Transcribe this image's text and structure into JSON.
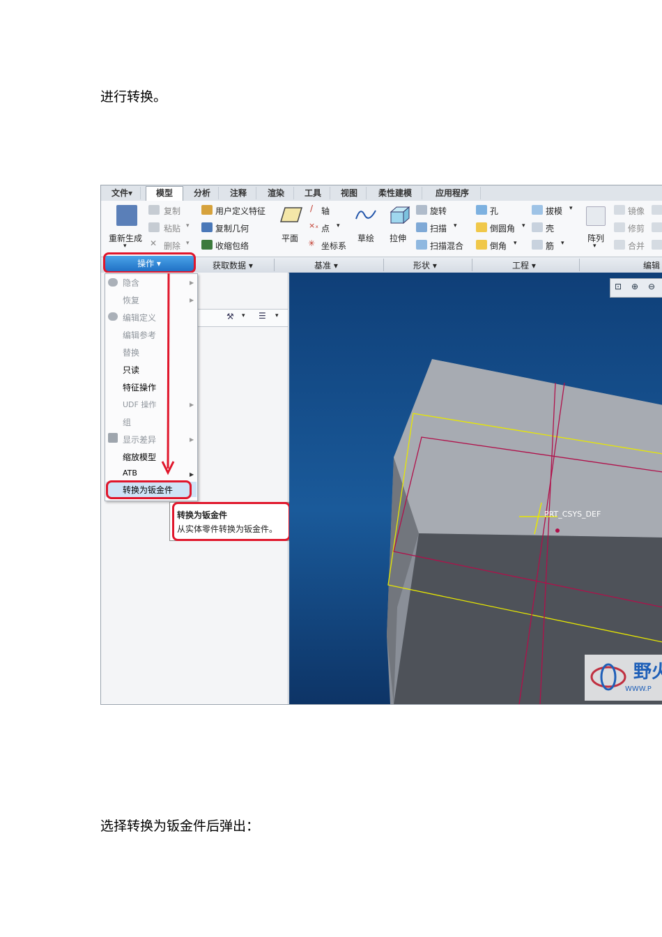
{
  "text_top": "进行转换。",
  "text_bottom": "选择转换为钣金件后弹出：",
  "tabs": [
    "文件▾",
    "模型",
    "分析",
    "注释",
    "渲染",
    "工具",
    "视图",
    "柔性建模",
    "应用程序"
  ],
  "ribbon": {
    "regen": "重新生成",
    "copy": "复制",
    "paste": "粘贴",
    "delete": "删除",
    "udf": "用户定义特征",
    "copy_geom": "复制几何",
    "shrinkwrap": "收缩包络",
    "plane": "平面",
    "axis": "轴",
    "point": "点",
    "csys": "坐标系",
    "sketch": "草绘",
    "extrude": "拉伸",
    "revolve": "旋转",
    "sweep": "扫描",
    "swept_blend": "扫描混合",
    "hole": "孔",
    "round": "倒圆角",
    "chamfer": "倒角",
    "draft": "拔模",
    "shell": "壳",
    "rib": "筋",
    "pattern": "阵列",
    "mirror": "镜像",
    "trim": "修剪",
    "merge": "合并"
  },
  "groups": {
    "operations": "操作 ▾",
    "get_data": "获取数据 ▾",
    "datum": "基准 ▾",
    "shapes": "形状 ▾",
    "engineering": "工程 ▾",
    "editing": "编辑"
  },
  "menu": [
    {
      "label": "隐含",
      "disabled": true,
      "submenu": true
    },
    {
      "label": "恢复",
      "disabled": true,
      "submenu": true
    },
    {
      "label": "编辑定义",
      "disabled": true,
      "submenu": false
    },
    {
      "label": "编辑参考",
      "disabled": true,
      "submenu": false
    },
    {
      "label": "替换",
      "disabled": true,
      "submenu": false
    },
    {
      "label": "只读",
      "disabled": false,
      "submenu": false
    },
    {
      "label": "特征操作",
      "disabled": false,
      "submenu": false
    },
    {
      "label": "UDF 操作",
      "disabled": true,
      "submenu": true
    },
    {
      "label": "组",
      "disabled": true,
      "submenu": false
    },
    {
      "label": "显示差异",
      "disabled": true,
      "submenu": true
    },
    {
      "label": "缩放模型",
      "disabled": false,
      "submenu": false
    },
    {
      "label": "ATB",
      "disabled": false,
      "submenu": true
    },
    {
      "label": "转换为钣金件",
      "disabled": false,
      "submenu": false
    }
  ],
  "tooltip": {
    "title": "转换为钣金件",
    "desc": "从实体零件转换为钣金件。"
  },
  "csys_label": "PRT_CSYS_DEF",
  "watermark": "野火",
  "watermark_url": "WWW.P",
  "colors": {
    "highlight": "#e0162b",
    "datum": "#b0104a",
    "edge": "#e8e800"
  }
}
